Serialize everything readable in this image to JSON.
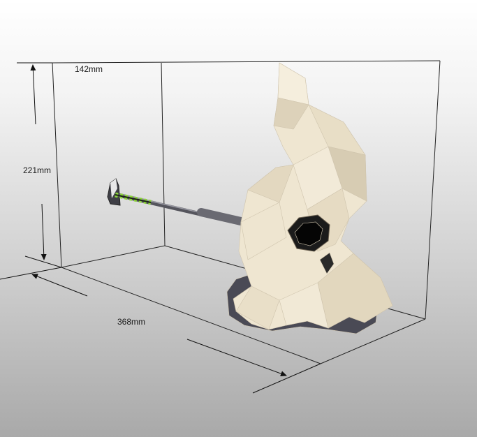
{
  "dimensions": {
    "depth": "142mm",
    "height": "221mm",
    "width": "368mm"
  },
  "model": {
    "name": ""
  },
  "colors": {
    "bounding_box": "#222222",
    "model_body": "#efe6d1",
    "model_shadow": "#4a4a55",
    "sword_handle": "#6a6a72",
    "sword_wrap": "#8bd43a"
  }
}
